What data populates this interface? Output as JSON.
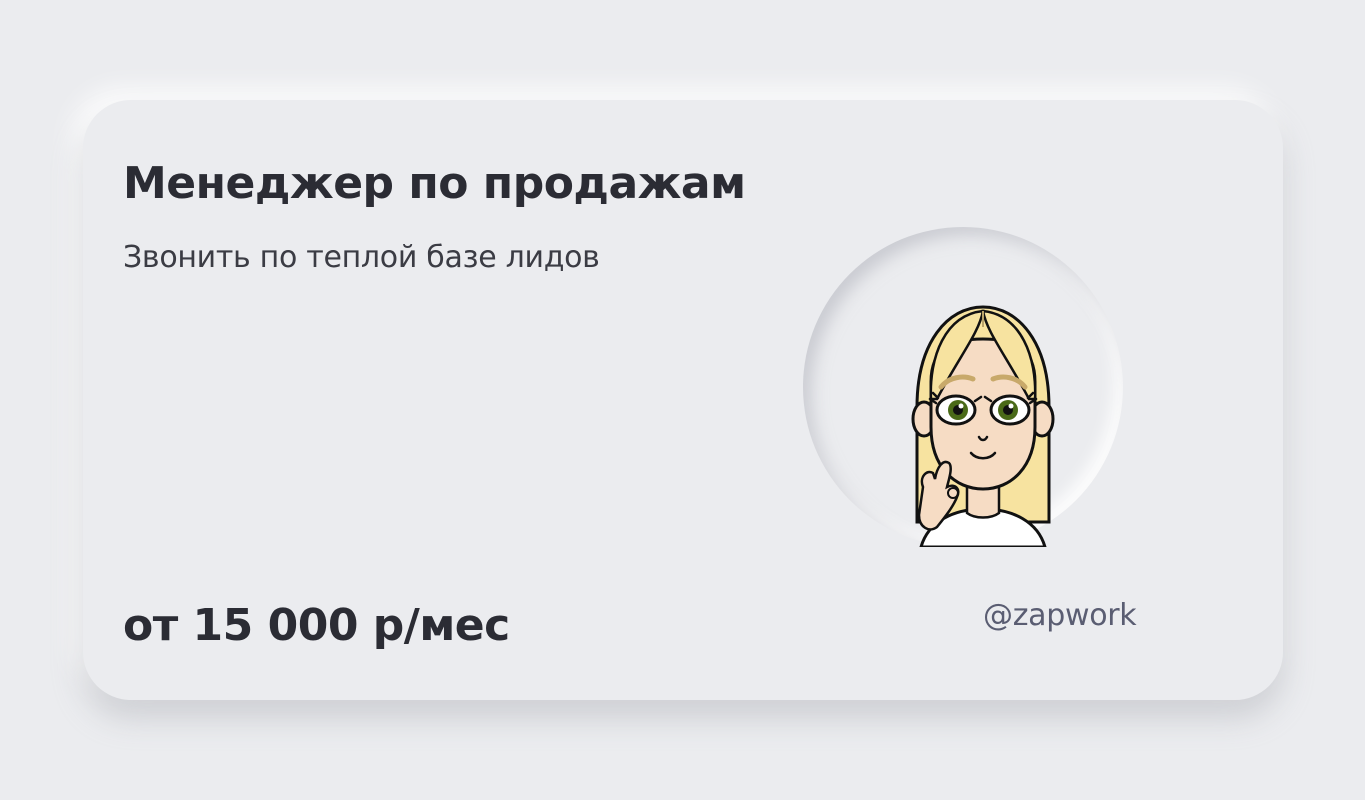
{
  "card": {
    "title": "Менеджер по продажам",
    "subtitle": "Звонить по теплой базе лидов",
    "price": "от 15 000 р/мес",
    "handle": "@zapwork",
    "avatar_icon": "cartoon-woman-avatar"
  },
  "colors": {
    "background": "#ebecef",
    "title_text": "#2b2c34",
    "handle_text": "#5a5d72",
    "hair": "#f7e3a0",
    "skin": "#f6dcc4",
    "eyes": "#4a6a18"
  }
}
